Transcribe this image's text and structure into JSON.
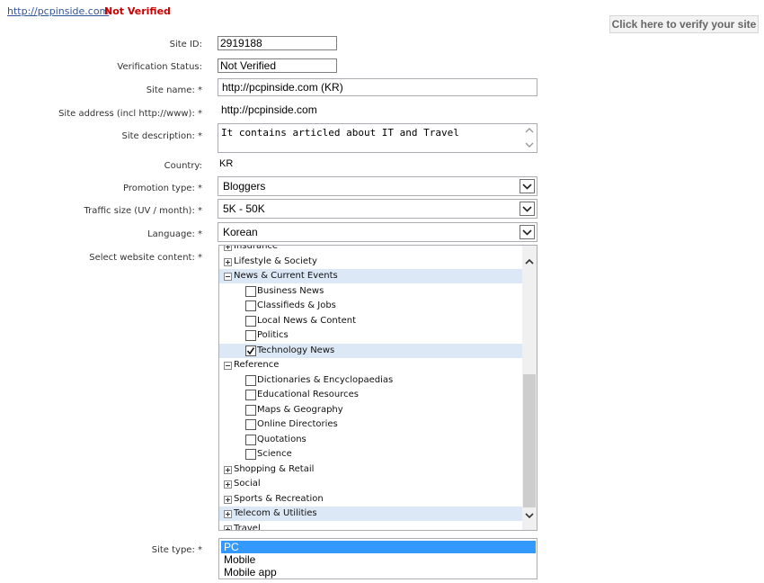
{
  "header": {
    "site_link": "http://pcpinside.com",
    "status_text": "Not Verified",
    "verify_button": "Click here to verify your site"
  },
  "form": {
    "site_id": {
      "label": "Site ID:",
      "value": "2919188"
    },
    "verification_status": {
      "label": "Verification Status:",
      "value": "Not Verified"
    },
    "site_name": {
      "label": "Site name: *",
      "value": "http://pcpinside.com (KR)"
    },
    "site_address": {
      "label": "Site address (incl http://www): *",
      "value": "http://pcpinside.com"
    },
    "site_description": {
      "label": "Site description: *",
      "value": "It contains articled about IT and Travel"
    },
    "country": {
      "label": "Country:",
      "value": "KR"
    },
    "promotion_type": {
      "label": "Promotion type: *",
      "value": "Bloggers"
    },
    "traffic_size": {
      "label": "Traffic size (UV / month): *",
      "value": "5K - 50K"
    },
    "language": {
      "label": "Language: *",
      "value": "Korean"
    },
    "website_content": {
      "label": "Select website content: *",
      "tree": [
        {
          "label": "Insurance",
          "kind": "category",
          "expanded": false
        },
        {
          "label": "Lifestyle & Society",
          "kind": "category",
          "expanded": false
        },
        {
          "label": "News & Current Events",
          "kind": "category",
          "expanded": true
        },
        {
          "label": "Business News",
          "kind": "item",
          "checked": false
        },
        {
          "label": "Classifieds & Jobs",
          "kind": "item",
          "checked": false
        },
        {
          "label": "Local News & Content",
          "kind": "item",
          "checked": false
        },
        {
          "label": "Politics",
          "kind": "item",
          "checked": false
        },
        {
          "label": "Technology News",
          "kind": "item",
          "checked": true
        },
        {
          "label": "Reference",
          "kind": "category",
          "expanded": true
        },
        {
          "label": "Dictionaries & Encyclopaedias",
          "kind": "item",
          "checked": false
        },
        {
          "label": "Educational Resources",
          "kind": "item",
          "checked": false
        },
        {
          "label": "Maps & Geography",
          "kind": "item",
          "checked": false
        },
        {
          "label": "Online Directories",
          "kind": "item",
          "checked": false
        },
        {
          "label": "Quotations",
          "kind": "item",
          "checked": false
        },
        {
          "label": "Science",
          "kind": "item",
          "checked": false
        },
        {
          "label": "Shopping & Retail",
          "kind": "category",
          "expanded": false
        },
        {
          "label": "Social",
          "kind": "category",
          "expanded": false
        },
        {
          "label": "Sports & Recreation",
          "kind": "category",
          "expanded": false
        },
        {
          "label": "Telecom & Utilities",
          "kind": "category",
          "expanded": false
        },
        {
          "label": "Travel",
          "kind": "category",
          "expanded": false
        }
      ]
    },
    "site_type": {
      "label": "Site type: *",
      "options": [
        "PC",
        "Mobile",
        "Mobile app"
      ],
      "selected": "PC"
    }
  },
  "colors": {
    "status_red": "#cc0000",
    "link_blue": "#335599",
    "selection_blue": "#3399ff",
    "row_highlight": "#dde8f6"
  }
}
